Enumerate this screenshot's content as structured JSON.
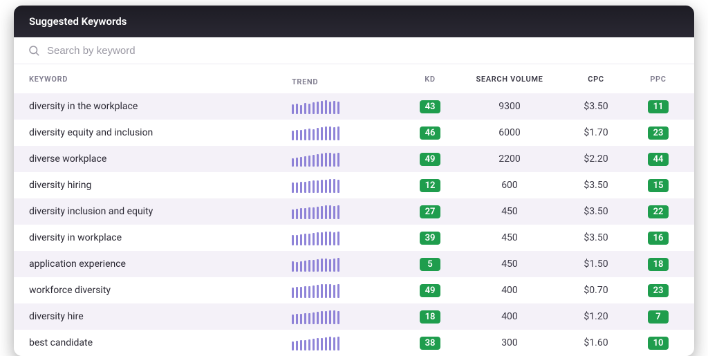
{
  "header": {
    "title": "Suggested Keywords"
  },
  "search": {
    "placeholder": "Search by keyword"
  },
  "columns": {
    "keyword": "KEYWORD",
    "trend": "TREND",
    "kd": "KD",
    "volume": "SEARCH VOLUME",
    "cpc": "CPC",
    "ppc": "PPC"
  },
  "colors": {
    "badge": "#1f9d4d",
    "trendBar": "#7b6fd1"
  },
  "rows": [
    {
      "keyword": "diversity in the workplace",
      "trend": [
        10,
        11,
        9,
        12,
        11,
        13,
        14,
        15,
        16,
        14,
        15,
        14
      ],
      "kd": 43,
      "volume": "9300",
      "cpc": "$3.50",
      "ppc": 11
    },
    {
      "keyword": "diversity equity and inclusion",
      "trend": [
        9,
        10,
        10,
        11,
        12,
        11,
        13,
        14,
        15,
        15,
        14,
        15
      ],
      "kd": 46,
      "volume": "6000",
      "cpc": "$1.70",
      "ppc": 23
    },
    {
      "keyword": "diverse workplace",
      "trend": [
        8,
        9,
        10,
        11,
        12,
        13,
        14,
        15,
        16,
        16,
        15,
        16
      ],
      "kd": 49,
      "volume": "2200",
      "cpc": "$2.20",
      "ppc": 44
    },
    {
      "keyword": "diversity hiring",
      "trend": [
        10,
        10,
        11,
        11,
        12,
        13,
        13,
        14,
        14,
        15,
        15,
        14
      ],
      "kd": 12,
      "volume": "600",
      "cpc": "$3.50",
      "ppc": 15
    },
    {
      "keyword": "diversity inclusion and equity",
      "trend": [
        9,
        10,
        11,
        11,
        12,
        12,
        13,
        14,
        15,
        15,
        14,
        15
      ],
      "kd": 27,
      "volume": "450",
      "cpc": "$3.50",
      "ppc": 22
    },
    {
      "keyword": "diversity in workplace",
      "trend": [
        10,
        10,
        11,
        12,
        12,
        13,
        14,
        14,
        15,
        15,
        14,
        15
      ],
      "kd": 39,
      "volume": "450",
      "cpc": "$3.50",
      "ppc": 16
    },
    {
      "keyword": "application experience",
      "trend": [
        11,
        10,
        11,
        12,
        13,
        13,
        14,
        15,
        15,
        14,
        15,
        16
      ],
      "kd": 5,
      "volume": "450",
      "cpc": "$1.50",
      "ppc": 18
    },
    {
      "keyword": "workforce diversity",
      "trend": [
        10,
        11,
        11,
        12,
        12,
        13,
        14,
        15,
        15,
        15,
        14,
        15
      ],
      "kd": 49,
      "volume": "400",
      "cpc": "$0.70",
      "ppc": 23
    },
    {
      "keyword": "diversity hire",
      "trend": [
        9,
        10,
        10,
        11,
        11,
        12,
        13,
        14,
        14,
        15,
        15,
        14
      ],
      "kd": 18,
      "volume": "400",
      "cpc": "$1.20",
      "ppc": 7
    },
    {
      "keyword": "best candidate",
      "trend": [
        8,
        9,
        10,
        10,
        11,
        12,
        13,
        13,
        14,
        15,
        14,
        15
      ],
      "kd": 38,
      "volume": "300",
      "cpc": "$1.60",
      "ppc": 10
    }
  ]
}
